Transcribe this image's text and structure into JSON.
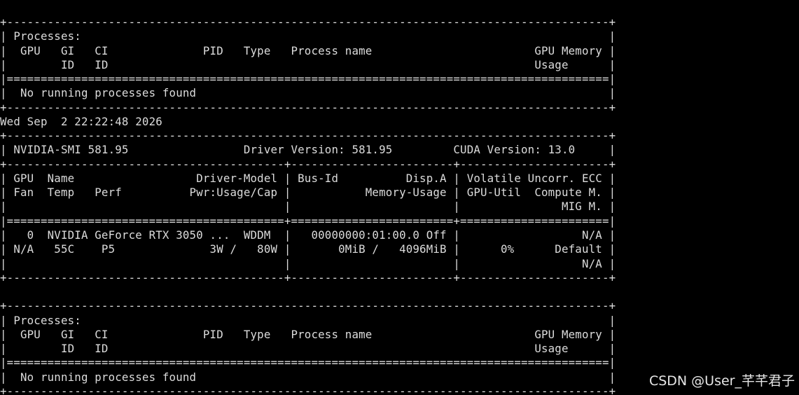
{
  "terminal": {
    "lines": [
      "+-----------------------------------------------------------------------------------------+",
      "| Processes:                                                                              |",
      "|  GPU   GI   CI              PID   Type   Process name                        GPU Memory |",
      "|        ID   ID                                                               Usage      |",
      "|=========================================================================================|",
      "|  No running processes found                                                             |",
      "+-----------------------------------------------------------------------------------------+",
      "Wed Sep  2 22:22:48 2026",
      "+-----------------------------------------------------------------------------------------+",
      "| NVIDIA-SMI 581.95                 Driver Version: 581.95         CUDA Version: 13.0     |",
      "+-----------------------------------------+------------------------+----------------------+",
      "| GPU  Name                  Driver-Model | Bus-Id          Disp.A | Volatile Uncorr. ECC |",
      "| Fan  Temp   Perf          Pwr:Usage/Cap |           Memory-Usage | GPU-Util  Compute M. |",
      "|                                         |                        |               MIG M. |",
      "|=========================================+========================+======================|",
      "|   0  NVIDIA GeForce RTX 3050 ...  WDDM  |   00000000:01:00.0 Off |                  N/A |",
      "| N/A   55C    P5              3W /   80W |       0MiB /   4096MiB |      0%      Default |",
      "|                                         |                        |                  N/A |",
      "+-----------------------------------------+------------------------+----------------------+",
      "",
      "+-----------------------------------------------------------------------------------------+",
      "| Processes:                                                                              |",
      "|  GPU   GI   CI              PID   Type   Process name                        GPU Memory |",
      "|        ID   ID                                                               Usage      |",
      "|=========================================================================================|",
      "|  No running processes found                                                             |",
      "+-----------------------------------------------------------------------------------------+"
    ]
  },
  "watermark": {
    "text": "CSDN @User_芊芊君子"
  }
}
